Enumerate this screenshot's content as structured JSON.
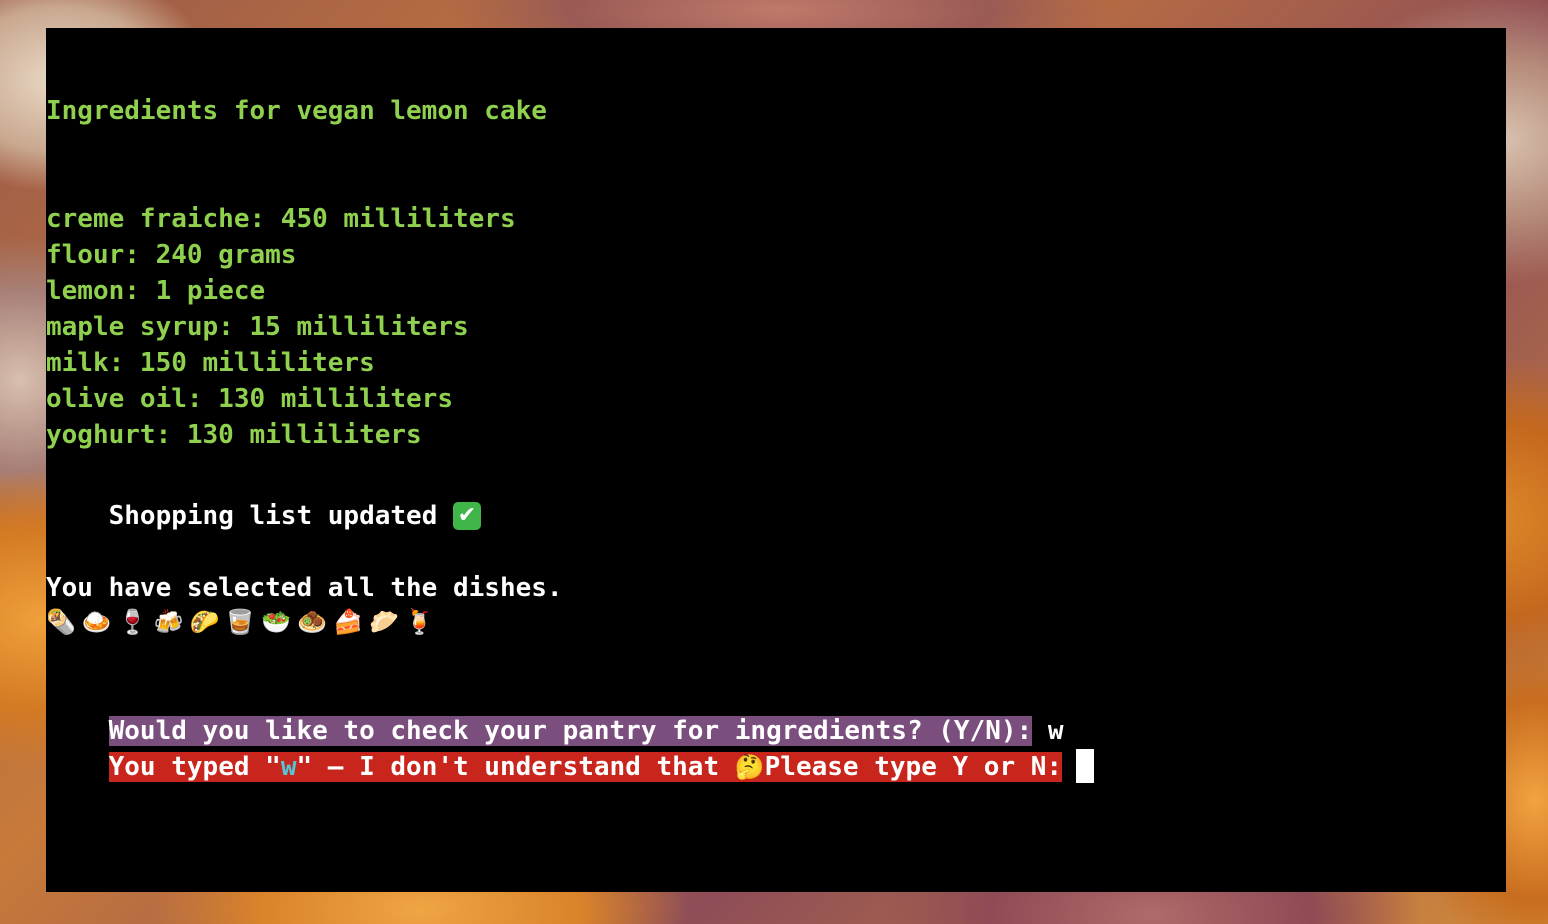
{
  "terminal": {
    "title_line": "Ingredients for vegan lemon cake",
    "ingredients": [
      "creme fraiche: 450 milliliters",
      "flour: 240 grams",
      "lemon: 1 piece",
      "maple syrup: 15 milliliters",
      "milk: 150 milliliters",
      "olive oil: 130 milliliters",
      "yoghurt: 130 milliliters"
    ],
    "status_text": "Shopping list updated ",
    "status_icon": "✔",
    "status_icon_name": "check-mark-button-icon",
    "selected_text": "You have selected all the dishes.",
    "dish_emojis": "🌯🍛🍷🍻🌮🥃🥗🧆🍰🥟🍹",
    "prompt_text": "Would you like to check your pantry for ingredients? (Y/N):",
    "typed_input": " w",
    "error_prefix": "You typed \"",
    "error_value": "w",
    "error_suffix": "\" — I don't understand that ",
    "error_emoji": "🤔",
    "error_request": "Please type Y or N:"
  },
  "colors": {
    "terminal_background": "#000000",
    "ingredient_text": "#8fd14f",
    "prompt_highlight": "#7a4f7d",
    "error_highlight": "#c8261c",
    "typed_value": "#4fc9d8"
  }
}
